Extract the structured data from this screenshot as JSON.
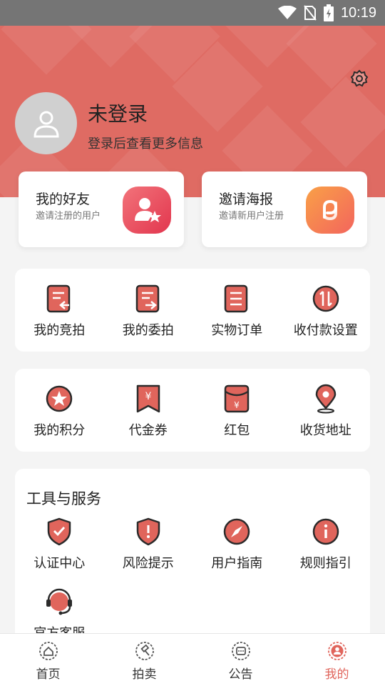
{
  "status_bar": {
    "time": "10:19"
  },
  "header": {
    "title": "未登录",
    "subtitle": "登录后查看更多信息"
  },
  "promos": [
    {
      "title": "我的好友",
      "subtitle": "邀请注册的用户"
    },
    {
      "title": "邀请海报",
      "subtitle": "邀请新用户注册"
    }
  ],
  "orders": [
    {
      "label": "我的竞拍",
      "icon": "bid-doc-icon"
    },
    {
      "label": "我的委拍",
      "icon": "consign-doc-icon"
    },
    {
      "label": "实物订单",
      "icon": "order-doc-icon"
    },
    {
      "label": "收付款设置",
      "icon": "transfer-icon"
    }
  ],
  "wallet": [
    {
      "label": "我的积分",
      "icon": "star-badge-icon"
    },
    {
      "label": "代金券",
      "icon": "voucher-icon"
    },
    {
      "label": "红包",
      "icon": "red-envelope-icon"
    },
    {
      "label": "收货地址",
      "icon": "location-pin-icon"
    }
  ],
  "tools": {
    "title": "工具与服务",
    "items": [
      {
        "label": "认证中心",
        "icon": "shield-check-icon"
      },
      {
        "label": "风险提示",
        "icon": "shield-alert-icon"
      },
      {
        "label": "用户指南",
        "icon": "compass-icon"
      },
      {
        "label": "规则指引",
        "icon": "info-icon"
      },
      {
        "label": "官方客服",
        "icon": "headset-icon"
      }
    ]
  },
  "tabbar": [
    {
      "label": "首页",
      "icon": "home-icon"
    },
    {
      "label": "拍卖",
      "icon": "gavel-icon"
    },
    {
      "label": "公告",
      "icon": "announcement-icon"
    },
    {
      "label": "我的",
      "icon": "profile-icon",
      "active": true
    }
  ],
  "colors": {
    "accent": "#e0655c",
    "header_bg": "#df6b63",
    "icon_dark": "#2b2b2b"
  }
}
